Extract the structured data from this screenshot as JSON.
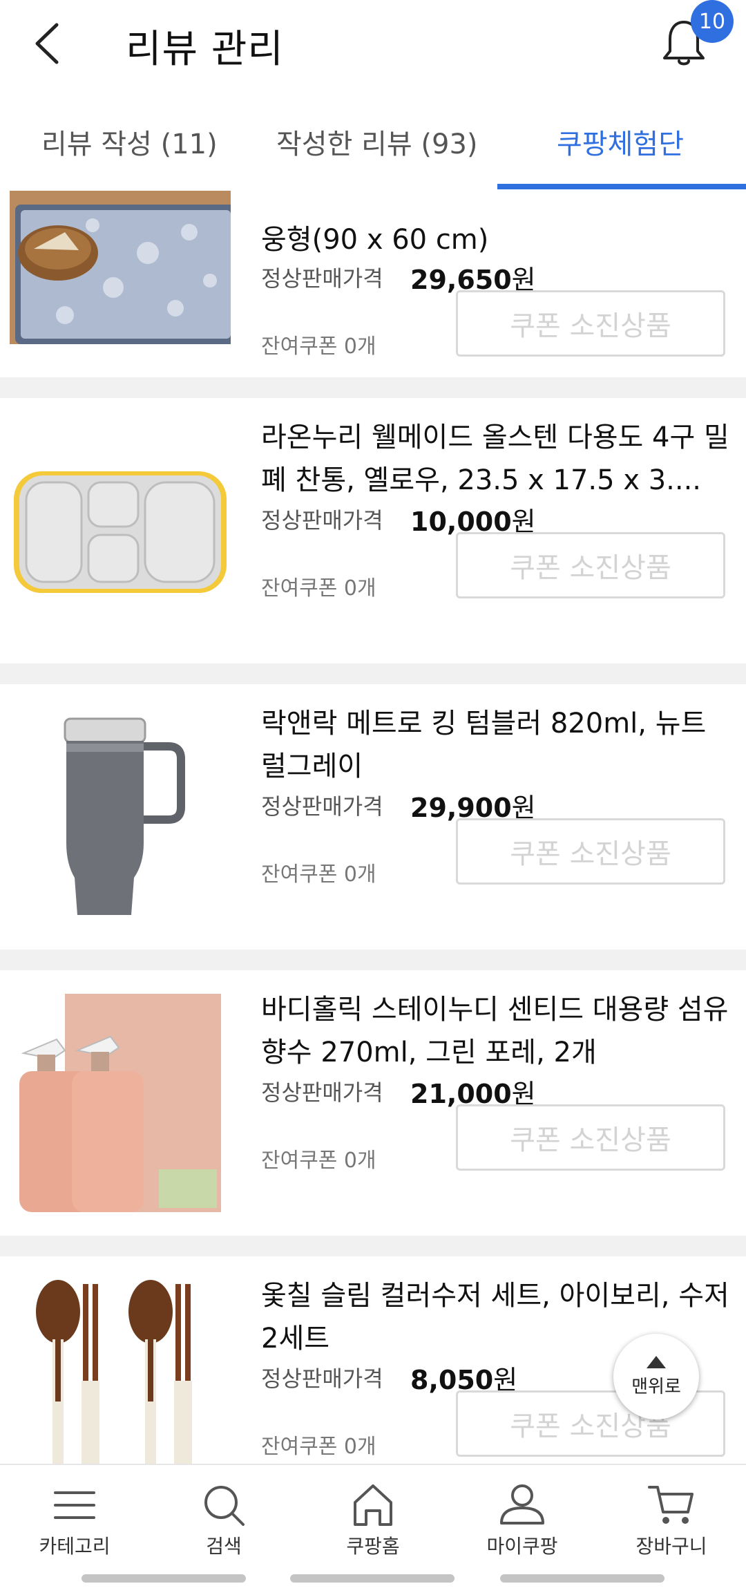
{
  "header": {
    "title": "리뷰 관리",
    "notification_count": "10"
  },
  "tabs": [
    {
      "label": "리뷰 작성 (11)"
    },
    {
      "label": "작성한 리뷰 (93)"
    },
    {
      "label": "쿠팡체험단",
      "active": true
    }
  ],
  "products": [
    {
      "name": "웅형(90 x 60 cm)",
      "price_label": "정상판매가격",
      "price": "29,650",
      "currency": "원",
      "remaining": "잔여쿠폰 0개",
      "button": "쿠폰 소진상품"
    },
    {
      "name": "라온누리 웰메이드 올스텐 다용도 4구 밀폐 찬통, 옐로우, 23.5 x 17.5 x 3....",
      "price_label": "정상판매가격",
      "price": "10,000",
      "currency": "원",
      "remaining": "잔여쿠폰 0개",
      "button": "쿠폰 소진상품"
    },
    {
      "name": "락앤락 메트로 킹 텀블러 820ml, 뉴트럴그레이",
      "price_label": "정상판매가격",
      "price": "29,900",
      "currency": "원",
      "remaining": "잔여쿠폰 0개",
      "button": "쿠폰 소진상품"
    },
    {
      "name": "바디홀릭 스테이누디 센티드 대용량 섬유향수 270ml, 그린 포레, 2개",
      "price_label": "정상판매가격",
      "price": "21,000",
      "currency": "원",
      "remaining": "잔여쿠폰 0개",
      "button": "쿠폰 소진상품"
    },
    {
      "name": "옻칠 슬림 컬러수저 세트, 아이보리, 수저 2세트",
      "price_label": "정상판매가격",
      "price": "8,050",
      "currency": "원",
      "remaining": "잔여쿠폰 0개",
      "button": "쿠폰 소진상품"
    }
  ],
  "top_button": {
    "label": "맨위로"
  },
  "bottom_nav": [
    {
      "label": "카테고리",
      "icon": "menu-icon"
    },
    {
      "label": "검색",
      "icon": "search-icon"
    },
    {
      "label": "쿠팡홈",
      "icon": "home-icon"
    },
    {
      "label": "마이쿠팡",
      "icon": "user-icon"
    },
    {
      "label": "장바구니",
      "icon": "cart-icon"
    }
  ],
  "colors": {
    "accent": "#2f6fe0",
    "disabled_text": "#d3d3d3",
    "divider": "#f1f1f1"
  }
}
